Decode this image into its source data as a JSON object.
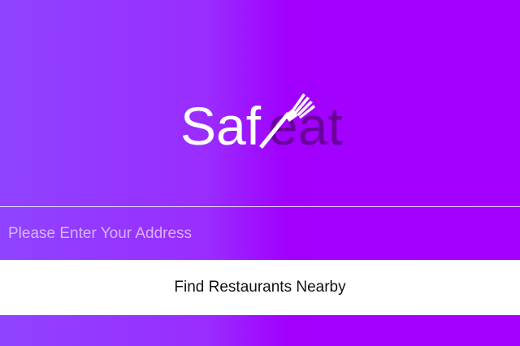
{
  "logo": {
    "part1": "Saf",
    "part2": "eat",
    "part1_color": "#ffffff",
    "part2_color": "#6a0099"
  },
  "address": {
    "placeholder": "Please Enter Your Address",
    "value": ""
  },
  "find_button": {
    "label": "Find Restaurants Nearby"
  },
  "colors": {
    "background_left": "#8f43ff",
    "background_right": "#a400ff",
    "button_bg": "#ffffff"
  }
}
